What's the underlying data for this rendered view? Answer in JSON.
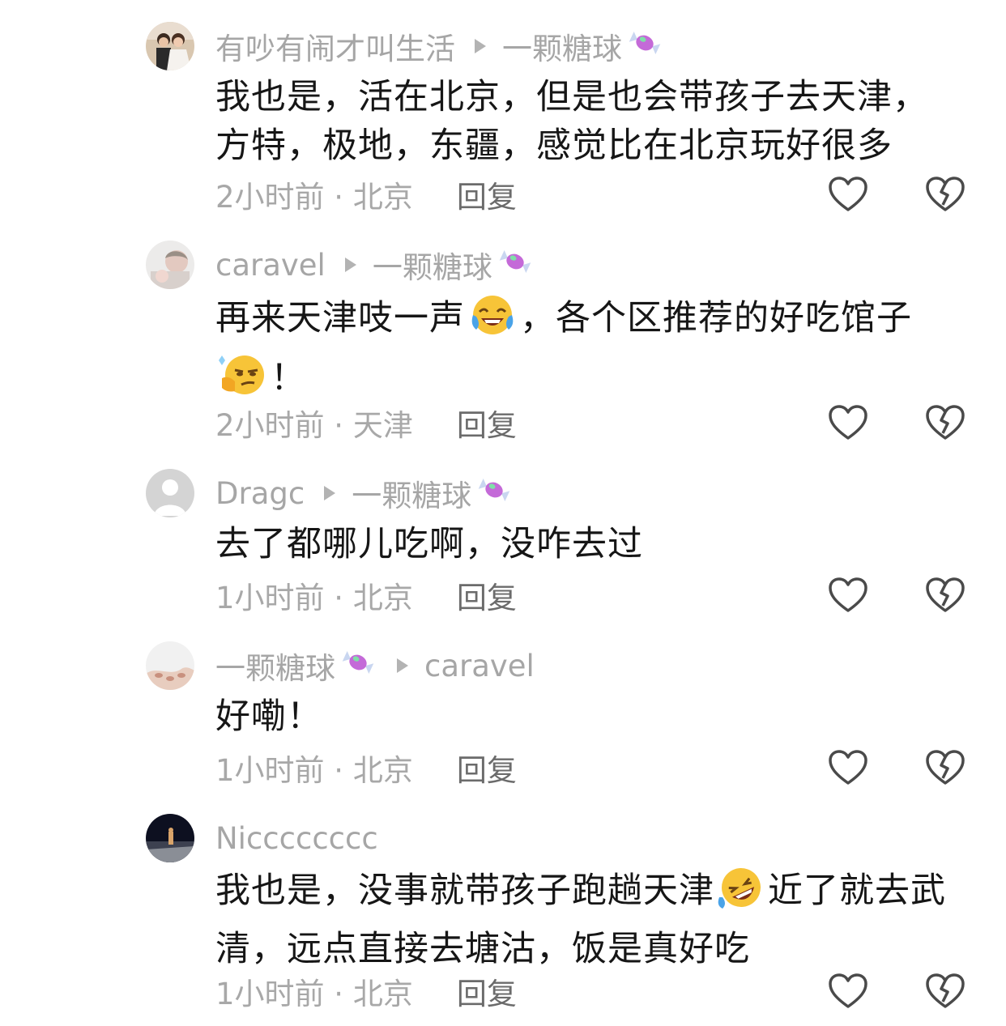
{
  "comments": [
    {
      "author": "有吵有闹才叫生活",
      "reply_to": "一颗糖球",
      "reply_to_emoji": "candy-icon",
      "text_segments": [
        "我也是，活在北京，但是也会带孩子去天津，",
        "方特，极地，东疆，感觉比在北京玩好很多"
      ],
      "time_location": "2小时前 · 北京",
      "reply_label": "回复"
    },
    {
      "author": "caravel",
      "reply_to": "一颗糖球",
      "reply_to_emoji": "candy-icon",
      "text_a": "再来天津吱一声",
      "emoji_a": "tears-of-joy-emoji",
      "text_b": "，各个区推荐的好吃馆子",
      "emoji_b": "smirk-thinking-emoji",
      "text_c": "！",
      "time_location": "2小时前 · 天津",
      "reply_label": "回复"
    },
    {
      "author": "Dragc",
      "reply_to": "一颗糖球",
      "reply_to_emoji": "candy-icon",
      "text": "去了都哪儿吃啊，没咋去过",
      "time_location": "1小时前 · 北京",
      "reply_label": "回复"
    },
    {
      "author": "一颗糖球",
      "author_emoji": "candy-icon",
      "reply_to": "caravel",
      "text": "好嘞！",
      "time_location": "1小时前 · 北京",
      "reply_label": "回复"
    },
    {
      "author": "Nicccccccc",
      "text_a": "我也是，没事就带孩子跑趟天津",
      "emoji_a": "rolling-laughing-emoji",
      "text_b": "近了就去武",
      "text_c": "清，远点直接去塘沽，饭是真好吃",
      "time_location": "1小时前 · 北京",
      "reply_label": "回复"
    }
  ],
  "colors": {
    "meta_gray": "#a6a6a6",
    "body_text": "#161616",
    "reply_gray": "#6b6b6b",
    "icon_stroke": "#4a4a4a"
  }
}
